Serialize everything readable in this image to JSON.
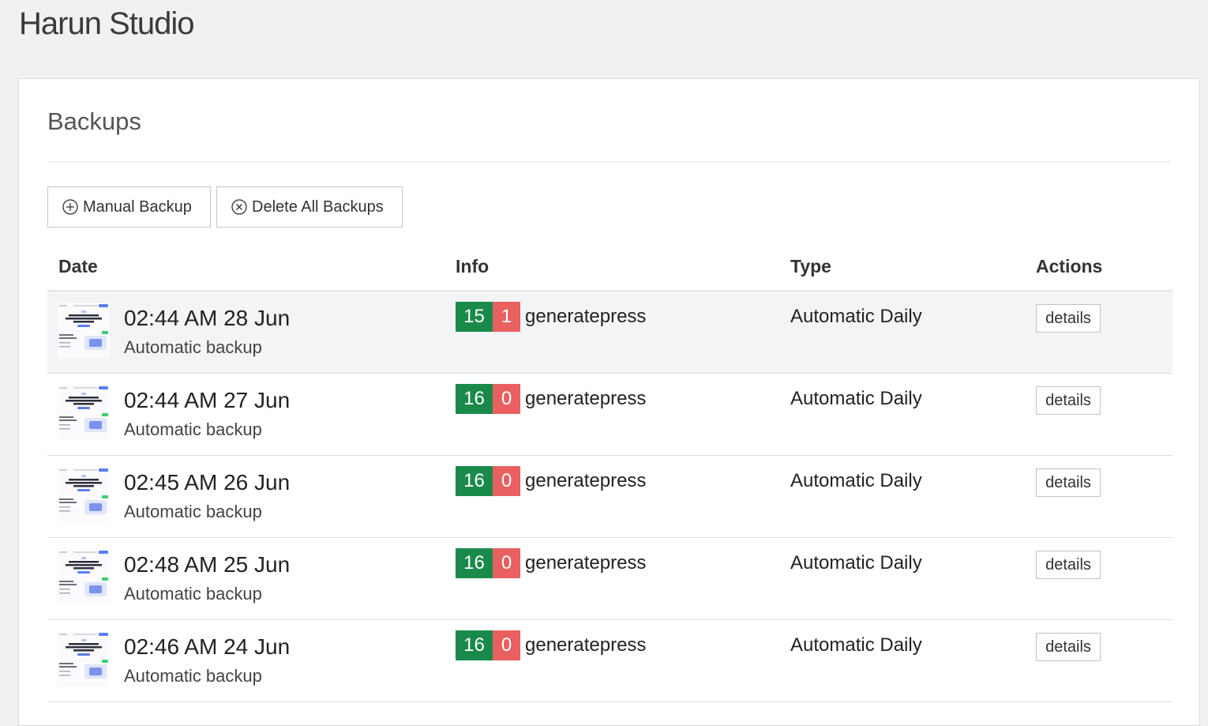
{
  "site": {
    "title": "Harun Studio"
  },
  "panel": {
    "title": "Backups"
  },
  "toolbar": {
    "manual_backup_label": "Manual Backup",
    "delete_all_label": "Delete All Backups"
  },
  "table": {
    "columns": [
      "Date",
      "Info",
      "Type",
      "Actions"
    ],
    "rows": [
      {
        "date": "02:44 AM 28 Jun",
        "subtitle": "Automatic backup",
        "count_ok": "15",
        "count_fail": "1",
        "theme": "generatepress",
        "type": "Automatic Daily",
        "action": "details"
      },
      {
        "date": "02:44 AM 27 Jun",
        "subtitle": "Automatic backup",
        "count_ok": "16",
        "count_fail": "0",
        "theme": "generatepress",
        "type": "Automatic Daily",
        "action": "details"
      },
      {
        "date": "02:45 AM 26 Jun",
        "subtitle": "Automatic backup",
        "count_ok": "16",
        "count_fail": "0",
        "theme": "generatepress",
        "type": "Automatic Daily",
        "action": "details"
      },
      {
        "date": "02:48 AM 25 Jun",
        "subtitle": "Automatic backup",
        "count_ok": "16",
        "count_fail": "0",
        "theme": "generatepress",
        "type": "Automatic Daily",
        "action": "details"
      },
      {
        "date": "02:46 AM 24 Jun",
        "subtitle": "Automatic backup",
        "count_ok": "16",
        "count_fail": "0",
        "theme": "generatepress",
        "type": "Automatic Daily",
        "action": "details"
      }
    ]
  },
  "colors": {
    "success": "#1a8a4a",
    "failure": "#e86060",
    "row_highlight": "#f3f4f5"
  },
  "icons": {
    "manual_backup": "plus-circle-icon",
    "delete_all": "x-circle-icon",
    "thumbnail": "site-screenshot-thumbnail"
  }
}
